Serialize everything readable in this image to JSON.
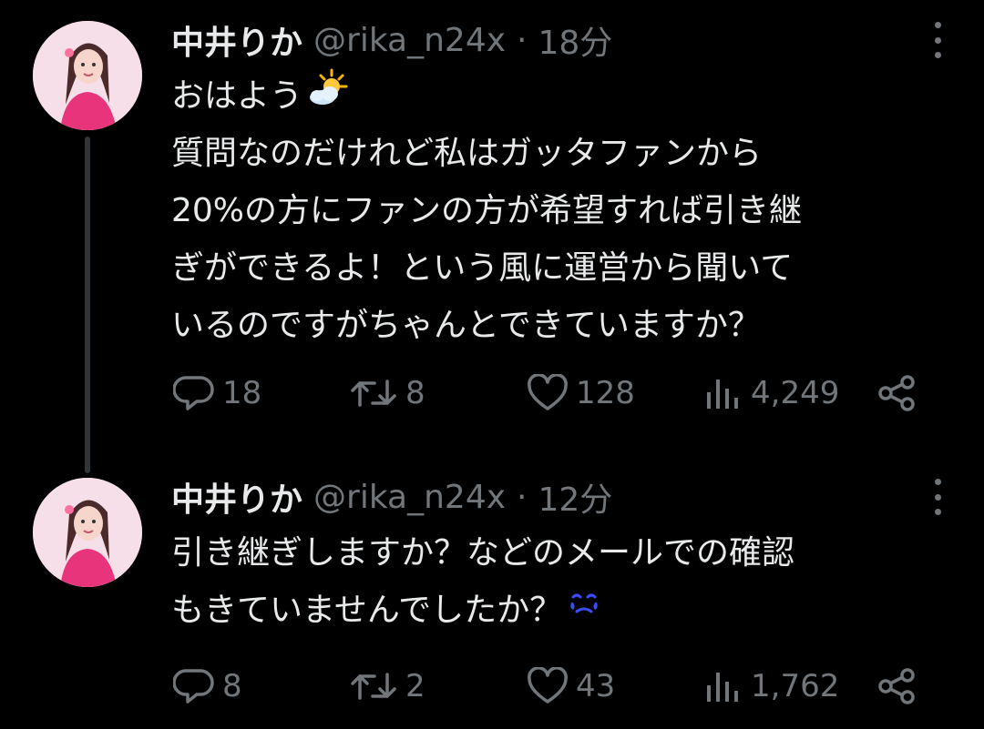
{
  "tweets": [
    {
      "author": {
        "name": "中井りか",
        "handle": "@rika_n24x"
      },
      "separator": "·",
      "time": "18分",
      "lines": [
        "おはよう",
        "質問なのだけれど私はガッタファンから",
        "20%の方にファンの方が希望すれば引き継",
        "ぎができるよ！という風に運営から聞いて",
        "いるのですがちゃんとできていますか？"
      ],
      "emoji": "sun-behind-cloud-emoji",
      "stats": {
        "replies": "18",
        "retweets": "8",
        "likes": "128",
        "views": "4,249"
      }
    },
    {
      "author": {
        "name": "中井りか",
        "handle": "@rika_n24x"
      },
      "separator": "·",
      "time": "12分",
      "lines": [
        "引き継ぎしますか？などのメールでの確認",
        "もきていませんでしたか？"
      ],
      "emoji": "crying-face-emoji",
      "stats": {
        "replies": "8",
        "retweets": "2",
        "likes": "43",
        "views": "1,762"
      }
    }
  ],
  "colors": {
    "background": "#000000",
    "text": "#e7e9ea",
    "secondary": "#71767b",
    "thread_line": "#333639"
  }
}
